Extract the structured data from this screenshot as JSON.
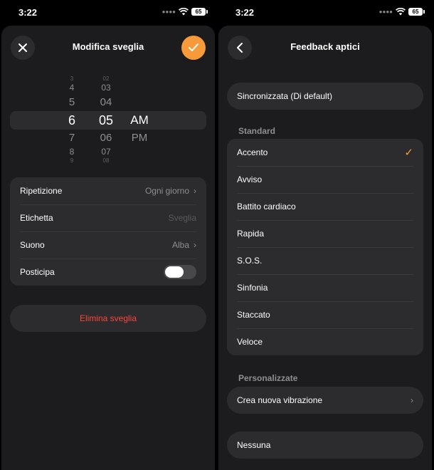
{
  "left": {
    "status": {
      "time": "3:22",
      "battery": "65"
    },
    "nav": {
      "title": "Modifica sveglia"
    },
    "picker": {
      "hours": [
        "3",
        "4",
        "5",
        "6",
        "7",
        "8",
        "9"
      ],
      "minutes": [
        "02",
        "03",
        "04",
        "05",
        "06",
        "07",
        "08"
      ],
      "ampm": [
        "AM",
        "PM"
      ],
      "selected_hour": "6",
      "selected_minute": "05",
      "selected_period": "AM"
    },
    "settings": {
      "repeat": {
        "label": "Ripetizione",
        "value": "Ogni giorno"
      },
      "label_row": {
        "label": "Etichetta",
        "placeholder": "Sveglia"
      },
      "sound": {
        "label": "Suono",
        "value": "Alba"
      },
      "snooze": {
        "label": "Posticipa",
        "enabled": false
      }
    },
    "delete_label": "Elimina sveglia"
  },
  "right": {
    "status": {
      "time": "3:22",
      "battery": "65"
    },
    "nav": {
      "title": "Feedback aptici"
    },
    "default_option": "Sincronizzata (Di default)",
    "standard": {
      "header": "Standard",
      "items": [
        "Accento",
        "Avviso",
        "Battito cardiaco",
        "Rapida",
        "S.O.S.",
        "Sinfonia",
        "Staccato",
        "Veloce"
      ],
      "selected": "Accento"
    },
    "custom": {
      "header": "Personalizzate",
      "create_label": "Crea nuova vibrazione"
    },
    "none_label": "Nessuna",
    "colors": {
      "accent": "#f79a3a",
      "destructive": "#ff453a",
      "card": "#2c2c2e",
      "sheet": "#1c1c1e"
    }
  }
}
